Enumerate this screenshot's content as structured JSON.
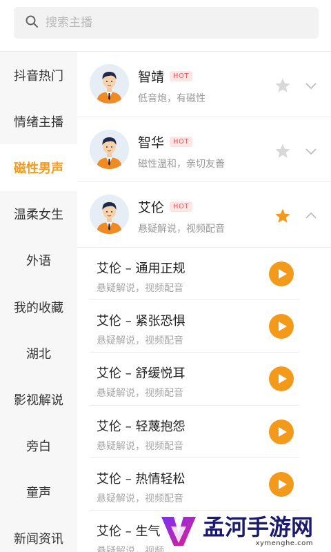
{
  "search": {
    "placeholder": "搜索主播"
  },
  "sidebar": {
    "items": [
      {
        "label": "抖音热门"
      },
      {
        "label": "情绪主播"
      },
      {
        "label": "磁性男声"
      },
      {
        "label": "温柔女生"
      },
      {
        "label": "外语"
      },
      {
        "label": "我的收藏"
      },
      {
        "label": "湖北"
      },
      {
        "label": "影视解说"
      },
      {
        "label": "旁白"
      },
      {
        "label": "童声"
      },
      {
        "label": "新闻资讯"
      }
    ],
    "active_index": 2
  },
  "anchors": [
    {
      "name": "智靖",
      "badge": "HOT",
      "desc": "低音炮，有磁性",
      "favorited": false,
      "expanded": false
    },
    {
      "name": "智华",
      "badge": "HOT",
      "desc": "磁性温和，亲切友善",
      "favorited": false,
      "expanded": false
    },
    {
      "name": "艾伦",
      "badge": "HOT",
      "desc": "悬疑解说，视频配音",
      "favorited": true,
      "expanded": true
    }
  ],
  "samples": [
    {
      "title": "艾伦 – 通用正规",
      "desc": "悬疑解说，视频配音"
    },
    {
      "title": "艾伦 – 紧张恐惧",
      "desc": "悬疑解说，视频配音"
    },
    {
      "title": "艾伦 – 舒缓悦耳",
      "desc": "悬疑解说，视频配音"
    },
    {
      "title": "艾伦 – 轻蔑抱怨",
      "desc": "悬疑解说，视频配音"
    },
    {
      "title": "艾伦 – 热情轻松",
      "desc": "悬疑解说，视频配音"
    },
    {
      "title": "艾伦 – 生气",
      "desc": "悬疑解说，视频"
    }
  ],
  "watermark": {
    "name": "孟河手游网",
    "url": "xymenghe.com"
  },
  "colors": {
    "accent": "#f59a1d",
    "play": "#f39a1a",
    "star_off": "#d8d8d8",
    "hot": "#e85a5a"
  }
}
